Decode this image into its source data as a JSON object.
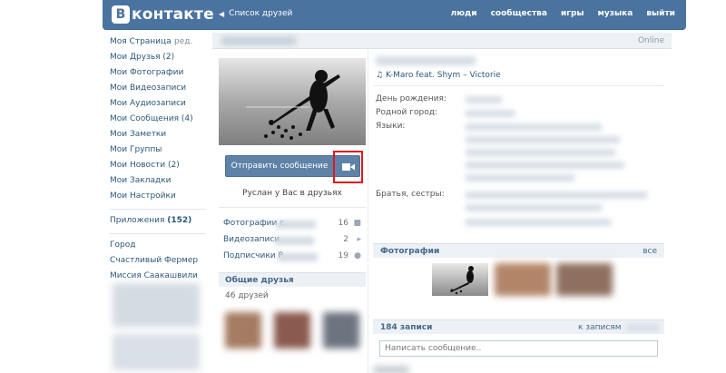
{
  "header": {
    "logo_letter": "В",
    "logo_text": "контакте",
    "back_link": "Список друзей",
    "nav": [
      "люди",
      "сообщества",
      "игры",
      "музыка",
      "выйти"
    ]
  },
  "sidebar": {
    "items": [
      {
        "label": "Моя Страница",
        "edit": "ред."
      },
      {
        "label": "Мои Друзья (2)"
      },
      {
        "label": "Мои Фотографии"
      },
      {
        "label": "Мои Видеозаписи"
      },
      {
        "label": "Мои Аудиозаписи"
      },
      {
        "label": "Мои Сообщения (4)"
      },
      {
        "label": "Мои Заметки"
      },
      {
        "label": "Мои Группы"
      },
      {
        "label": "Мои Новости (2)"
      },
      {
        "label": "Мои Закладки"
      },
      {
        "label": "Мои Настройки"
      }
    ],
    "apps": {
      "label": "Приложения",
      "count": "(152)"
    },
    "app_items": [
      "Город",
      "Счастливый Фермер",
      "Миссия Саакашвили"
    ]
  },
  "profile": {
    "online": "Online",
    "send_message_label": "Отправить сообщение",
    "friend_status": "Руслан у Вас в друзьях",
    "counters": [
      {
        "label": "Фотографии с",
        "count": "16",
        "icon": "camera-icon"
      },
      {
        "label": "Видеозаписи",
        "count": "2",
        "icon": "video-icon"
      },
      {
        "label": "Подписчики Р",
        "count": "19",
        "icon": "people-icon"
      }
    ],
    "mutual_friends": {
      "title": "Общие друзья",
      "count": "46 друзей"
    }
  },
  "info": {
    "audio_status": "K-Maro feat. Shym – Victorie",
    "birthday_label": "День рождения:",
    "hometown_label": "Родной город:",
    "languages_label": "Языки:",
    "siblings_label": "Братья, сестры:"
  },
  "photos": {
    "title": "Фотографии",
    "all": "все"
  },
  "wall": {
    "count": "184 записи",
    "to_posts": "к записям",
    "input_placeholder": "Написать сообщение.."
  },
  "colors": {
    "header": "#4a73a0",
    "link": "#2b587a",
    "button": "#5e82a8",
    "highlight": "#e0181e"
  }
}
